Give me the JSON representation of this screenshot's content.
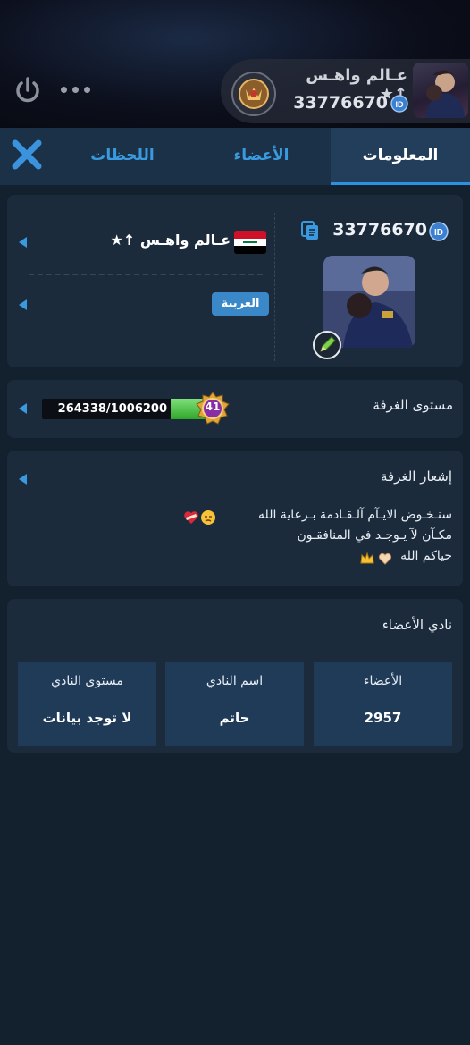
{
  "header": {
    "room_name": "ﻋـﺎﻟﻢ ﻭﺍﻫـﺲ ↑★",
    "room_id": "33776670",
    "id_badge": "ID"
  },
  "tabs": [
    {
      "label": "المعلومات",
      "active": true
    },
    {
      "label": "الأعضاء",
      "active": false
    },
    {
      "label": "اللحظات",
      "active": false
    }
  ],
  "info": {
    "room_id": "33776670",
    "id_badge": "ID",
    "room_name": "ﻋـﺎﻟﻢ ﻭﺍﻫـﺲ ↑★",
    "country_flag": "iraq-flag",
    "language": "العربية"
  },
  "level": {
    "label": "مستوى الغرفة",
    "progress_text": "264338/1006200",
    "progress": 0.263,
    "level_number": "41"
  },
  "notice": {
    "title": "إشعار الغرفة",
    "lines": [
      "سنـخـوض الايـآم آلـقـادمة بـرعاية الله",
      "مكـآن لآ يـوجـد في المنافقـون",
      "حياكم الله"
    ]
  },
  "club": {
    "title": "نادي الأعضاء",
    "cells": [
      {
        "label": "الأعضاء",
        "value": "2957"
      },
      {
        "label": "اسم النادي",
        "value": "حاتم"
      },
      {
        "label": "مستوى النادي",
        "value": "لا توجد بيانات"
      }
    ]
  },
  "colors": {
    "background": "#13212e",
    "card": "#1c2b3c",
    "tab_bar": "#1b3148",
    "accent": "#3a9adf",
    "progress_fill": "#3fbf3a",
    "club_cell": "#1f3b58"
  }
}
